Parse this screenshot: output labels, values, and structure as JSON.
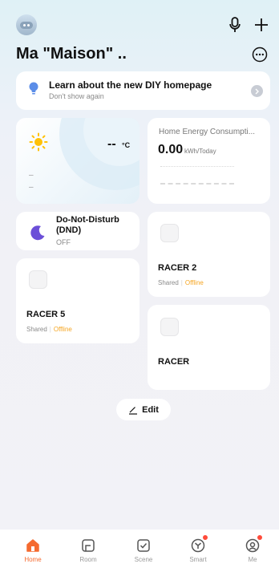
{
  "header": {
    "home_name": "Ma \"Maison\" ..",
    "icons": [
      "avatar",
      "microphone-icon",
      "plus-icon",
      "more-icon"
    ]
  },
  "banner": {
    "title": "Learn about the new DIY homepage",
    "subtitle": "Don't show again"
  },
  "weather": {
    "temperature": "--",
    "unit": "°C",
    "line1": "–",
    "line2": "–"
  },
  "energy": {
    "title": "Home Energy Consumpti...",
    "value": "0.00",
    "unit": "kWh/Today"
  },
  "scene_dnd": {
    "title": "Do-Not-Disturb (DND)",
    "state": "OFF"
  },
  "devices": [
    {
      "name": "RACER 2",
      "shared": "Shared",
      "status": "Offline"
    },
    {
      "name": "RACER 5",
      "shared": "Shared",
      "status": "Offline"
    },
    {
      "name": "RACER"
    }
  ],
  "edit": {
    "label": "Edit"
  },
  "tabs": [
    {
      "label": "Home",
      "active": true
    },
    {
      "label": "Room"
    },
    {
      "label": "Scene"
    },
    {
      "label": "Smart",
      "badge": true
    },
    {
      "label": "Me",
      "badge": true
    }
  ],
  "colors": {
    "accent": "#f56a2f",
    "offline": "#f5a623",
    "badge": "#ff4b3a"
  }
}
